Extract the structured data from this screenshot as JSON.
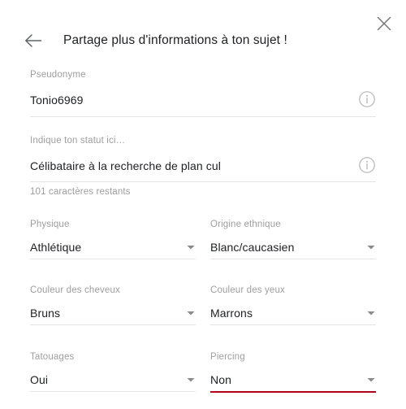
{
  "header": {
    "title": "Partage plus d'informations à ton sujet !",
    "back_icon": "arrow-left-icon",
    "close_icon": "close-icon"
  },
  "colors": {
    "accent_error": "#b00020",
    "label": "#9e9e9e",
    "value": "#202124",
    "rule": "#e4e4e4",
    "background": "#ffffff"
  },
  "fields": {
    "nickname": {
      "label": "Pseudonyme",
      "value": "Tonio6969",
      "placeholder": "Pseudonyme",
      "info_icon": "info-circle-icon"
    },
    "status": {
      "label": "Indique ton statut ici…",
      "value": "Célibataire à la recherche de plan cul",
      "placeholder": "Indique ton statut ici…",
      "helper": "101 caractères restants",
      "info_icon": "info-circle-icon"
    },
    "physique": {
      "label": "Physique",
      "value": "Athlétique",
      "caret_icon": "chevron-down-icon"
    },
    "origine": {
      "label": "Origine ethnique",
      "value": "Blanc/caucasien",
      "caret_icon": "chevron-down-icon"
    },
    "cheveux": {
      "label": "Couleur des cheveux",
      "value": "Bruns",
      "caret_icon": "chevron-down-icon"
    },
    "yeux": {
      "label": "Couleur des yeux",
      "value": "Marrons",
      "caret_icon": "chevron-down-icon"
    },
    "tatouages": {
      "label": "Tatouages",
      "value": "Oui",
      "caret_icon": "chevron-down-icon"
    },
    "piercing": {
      "label": "Piercing",
      "value": "Non",
      "caret_icon": "chevron-down-icon",
      "state": "error"
    }
  }
}
